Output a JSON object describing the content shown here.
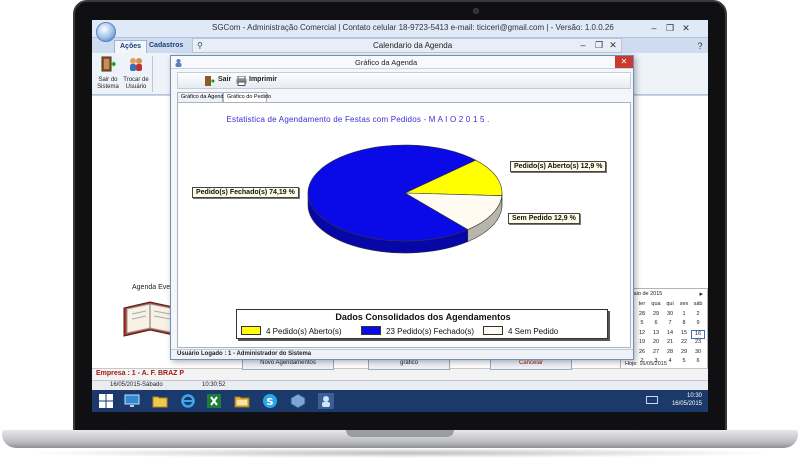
{
  "window": {
    "title": "SGCom - Administração Comercial | Contato celular 18-9723-5413 e-mail: ticiceri@gmail.com | - Versão: 1.0.0.26",
    "minimize": "–",
    "restore": "❐",
    "close": "✕",
    "help": "?"
  },
  "ribbon": {
    "tabs": [
      {
        "label": "Ações"
      },
      {
        "label": "Cadastros"
      }
    ],
    "buttons": [
      {
        "label": "Sair do Sistema"
      },
      {
        "label": "Trocar de Usuário"
      }
    ]
  },
  "agenda_window": {
    "title": "Calendario da Agenda"
  },
  "workspace": {
    "agenda_label": "Agenda Event",
    "empresa": "Empresa : 1 - A. F. BRAZ P",
    "buttons": [
      {
        "label": "Novo Agendamentos"
      },
      {
        "label": "gráfico"
      },
      {
        "label": "Cancelar"
      }
    ]
  },
  "statusbar": {
    "date": "16/05/2015-Sábado",
    "time": "10:30:52"
  },
  "calendar": {
    "month": "maio de 2015",
    "days_header": [
      "ter",
      "qua",
      "qui",
      "sex",
      "sáb"
    ],
    "rows": [
      [
        "28",
        "29",
        "30",
        "1",
        "2"
      ],
      [
        "5",
        "6",
        "7",
        "8",
        "9"
      ],
      [
        "12",
        "13",
        "14",
        "15",
        "16"
      ],
      [
        "19",
        "20",
        "21",
        "22",
        "23"
      ],
      [
        "26",
        "27",
        "28",
        "29",
        "30"
      ],
      [
        "2",
        "3",
        "4",
        "5",
        "6"
      ]
    ],
    "today": "Hoje: 16/05/2015",
    "selected_day": "16"
  },
  "taskbar": {
    "time": "10:30",
    "date": "16/05/2015"
  },
  "dialog": {
    "title": "Gráfico da Agenda",
    "toolbar": {
      "sair": "Sair",
      "imprimir": "Imprimir"
    },
    "tabs": [
      {
        "label": "Gráfico da Agenda"
      },
      {
        "label": "Gráfico do Pedido"
      }
    ],
    "status": "Usuário Logado : 1 - Administrador do Sistema",
    "close": "✕"
  },
  "chart_data": {
    "type": "pie",
    "title": "Estatistica de Agendamento de Festas com Pedidos - M A I O   2 0 1 5   .",
    "legend_title": "Dados Consolidados dos Agendamentos",
    "legend": [
      {
        "label": "4 Pedido(s) Aberto(s)",
        "color": "#ffff00"
      },
      {
        "label": "23 Pedido(s) Fechado(s)",
        "color": "#0a0ae8"
      },
      {
        "label": "4 Sem Pedido",
        "color": "#fffbf0"
      }
    ],
    "slices": [
      {
        "name": "Pedido(s) Aberto(s)",
        "count": 4,
        "percent": 12.9,
        "label": "Pedido(s) Aberto(s) 12,9 %",
        "color": "#ffff00"
      },
      {
        "name": "Sem Pedido",
        "count": 4,
        "percent": 12.9,
        "label": "Sem Pedido 12,9 %",
        "color": "#fffbf0"
      },
      {
        "name": "Pedido(s) Fechado(s)",
        "count": 23,
        "percent": 74.19,
        "label": "Pedido(s) Fechado(s) 74,19 %",
        "color": "#0a0ae8"
      }
    ],
    "legend_placement": "bottom"
  }
}
